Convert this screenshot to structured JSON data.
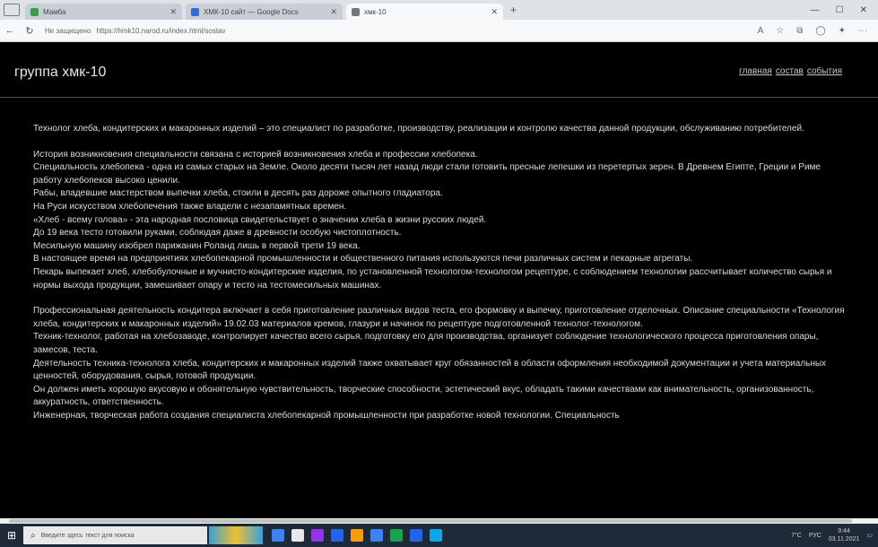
{
  "browser": {
    "tabs": [
      {
        "title": "Мамба",
        "color": "#3d9a4a",
        "active": false
      },
      {
        "title": "ХМК-10 сайт — Google Docs",
        "color": "#2b6fd6",
        "active": false
      },
      {
        "title": "хмк-10",
        "color": "#777777",
        "active": true
      }
    ],
    "new_tab": "+",
    "window_controls": {
      "minimize": "—",
      "maximize": "☐",
      "close": "✕"
    },
    "nav": {
      "back": "←",
      "refresh": "↻"
    },
    "url": "https://hmk10.narod.ru/index.html/sostav",
    "url_prefix": "Не защищено"
  },
  "site": {
    "title": "группа хмк-10",
    "nav": [
      {
        "label": "главная"
      },
      {
        "label": "состав"
      },
      {
        "label": "события"
      }
    ]
  },
  "content": {
    "paragraphs": [
      "Технолог хлеба, кондитерских и макаронных изделий – это специалист по разработке, производству, реализации и контролю качества данной продукции, обслуживанию потребителей.",
      "",
      "История возникновения специальности связана с историей возникновения хлеба и профессии хлебопека.",
      "Специальность хлебопека - одна из самых старых на Земле. Около десяти тысяч лет назад люди стали готовить пресные лепешки из перетертых зерен. В Древнем Египте, Греции и Риме работу хлебопеков высоко ценили.",
      "Рабы, владевшие мастерством выпечки хлеба, стоили в десять раз дороже опытного гладиатора.",
      "На Руси искусством хлебопечения также владели с незапамятных времен.",
      "«Хлеб - всему голова» - эта народная пословица свидетельствует о значении хлеба в жизни русских людей.",
      "До 19 века тесто готовили руками, соблюдая даже в древности особую чистоплотность.",
      "Месильную машину изобрел парижанин Роланд лишь в первой трети 19 века.",
      "В настоящее время на предприятиях хлебопекарной промышленности и общественного питания используются печи различных систем и пекарные агрегаты.",
      "Пекарь выпекает хлеб, хлебобулочные и мучнисто-кондитерские изделия, по установленной технологом-технологом рецептуре, с соблюдением технологии рассчитывает количество сырья и нормы выхода продукции, замешивает опару и тесто на тестомесильных машинах.",
      "",
      "Профессиональная деятельность кондитера включает в себя приготовление различных видов теста, его формовку и выпечку, приготовление отделочных. Описание специальности «Технология хлеба, кондитерских и макаронных изделий» 19.02.03 материалов кремов, глазури и начинок по рецептуре подготовленной технолог-технологом.",
      "Техник-технолог, работая на хлебозаводе, контролирует качество всего сырья, подготовку его для производства, организует соблюдение технологического процесса приготовления опары, замесов, теста.",
      "Деятельность техника-технолога хлеба, кондитерских и макаронных изделий также охватывает круг обязанностей в области оформления необходимой документации и учета материальных ценностей, оборудования, сырья, готовой продукции.",
      "Он должен иметь хорошую вкусовую и обонятельную чувствительность, творческие способности, эстетический вкус, обладать такими качествами как внимательность, организованность, аккуратность, ответственность.",
      "Инженерная, творческая работа создания специалиста хлебопекарной промышленности при разработке новой технологии. Специальность"
    ]
  },
  "taskbar": {
    "start": "⊞",
    "search_placeholder": "Введите здесь текст для поиска",
    "apps": [
      "#3b82f6",
      "#e5e7eb",
      "#9333ea",
      "#2563eb",
      "#f59e0b",
      "#3b82f6",
      "#16a34a",
      "#2563eb",
      "#0ea5e9"
    ],
    "tray": {
      "weather": "7°C",
      "lang": "РУС",
      "time": "9:44",
      "date": "03.11.2021"
    }
  }
}
